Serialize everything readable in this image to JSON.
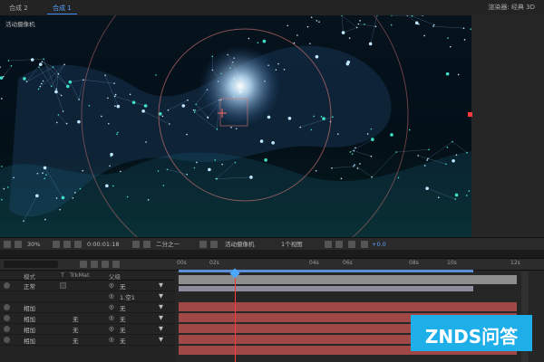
{
  "tabs": [
    {
      "label": "合成 2",
      "active": false
    },
    {
      "label": "合成 1",
      "active": true
    }
  ],
  "renderer": {
    "label": "渲染器:",
    "value": "经典 3D"
  },
  "viewer": {
    "camera_label": "活动摄像机"
  },
  "viewer_controls": {
    "zoom": "30%",
    "timecode": "0:00:01:18",
    "resolution": "二分之一",
    "camera": "活动摄像机",
    "views": "1个视图",
    "exposure": "+0.0"
  },
  "timeline": {
    "columns": {
      "mode": "模式",
      "t": "T",
      "trkmat": "TrkMat",
      "parent": "父级"
    },
    "ruler": [
      "00s",
      "02s",
      "04s",
      "06s",
      "08s",
      "10s",
      "12s"
    ],
    "rows": [
      {
        "mode": "正常",
        "trkmat": "",
        "parent": "无"
      },
      {
        "mode": "",
        "trkmat": "",
        "parent": "1.空1"
      },
      {
        "mode": "相加",
        "trkmat": "",
        "parent": "无"
      },
      {
        "mode": "相加",
        "trkmat": "无",
        "parent": "无"
      },
      {
        "mode": "相加",
        "trkmat": "无",
        "parent": "无"
      },
      {
        "mode": "相加",
        "trkmat": "无",
        "parent": "无"
      }
    ]
  },
  "watermark": {
    "text": "ZNDS问答"
  },
  "colors": {
    "accent": "#3d8fff",
    "cti": "#ff3a3a",
    "track": "#a04747",
    "watermark": "#1eaee8"
  }
}
